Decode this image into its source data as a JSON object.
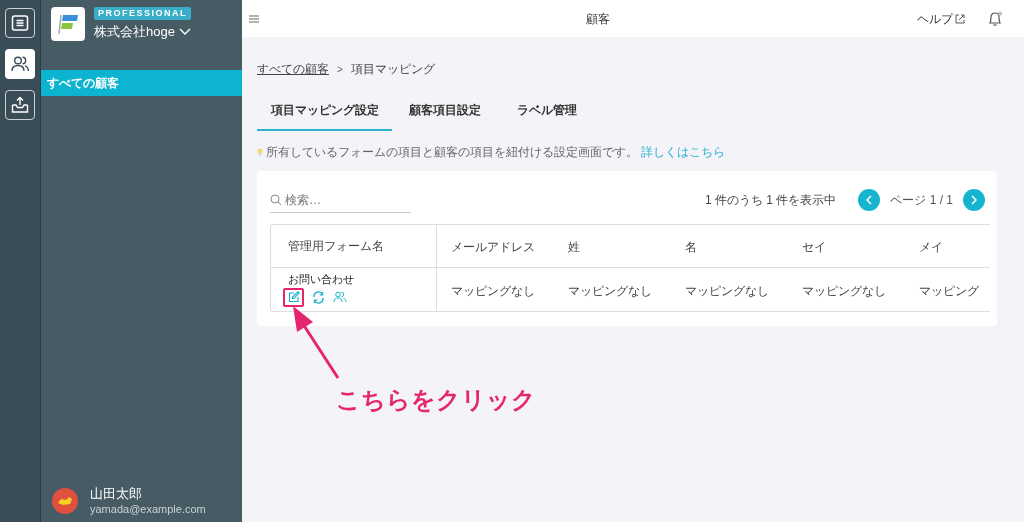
{
  "rail": {
    "items": [
      {
        "kind": "list",
        "selected": false
      },
      {
        "kind": "people",
        "selected": true
      },
      {
        "kind": "inbox",
        "selected": false
      }
    ]
  },
  "brand": {
    "badge": "PROFESSIONAL",
    "company": "株式会社hoge"
  },
  "sidebar": {
    "items": [
      {
        "label": "すべての顧客",
        "selected": true
      }
    ]
  },
  "user": {
    "name": "山田太郎",
    "email": "yamada@example.com"
  },
  "topbar": {
    "title": "顧客",
    "help": "ヘルプ"
  },
  "breadcrumb": {
    "items": [
      {
        "label": "すべての顧客",
        "kind": "link"
      },
      {
        "label": "項目マッピング",
        "kind": "current"
      }
    ],
    "separator": ">"
  },
  "tabs": [
    {
      "label": "項目マッピング設定",
      "selected": true
    },
    {
      "label": "顧客項目設定",
      "selected": false
    },
    {
      "label": "ラベル管理",
      "selected": false
    }
  ],
  "hint": {
    "text": "所有しているフォームの項目と顧客の項目を紐付ける設定画面です。",
    "link": "詳しくはこちら"
  },
  "search": {
    "placeholder": "検索…"
  },
  "pagination": {
    "summary": "1 件のうち 1 件を表示中",
    "page": "ページ 1 / 1"
  },
  "table": {
    "columns": [
      "管理用フォーム名",
      "メールアドレス",
      "姓",
      "名",
      "セイ",
      "メイ"
    ],
    "rows": [
      {
        "cells": [
          "お問い合わせ",
          "マッピングなし",
          "マッピングなし",
          "マッピングなし",
          "マッピングなし",
          "マッピング"
        ]
      }
    ]
  },
  "annotation": {
    "text": "こちらをクリック"
  }
}
